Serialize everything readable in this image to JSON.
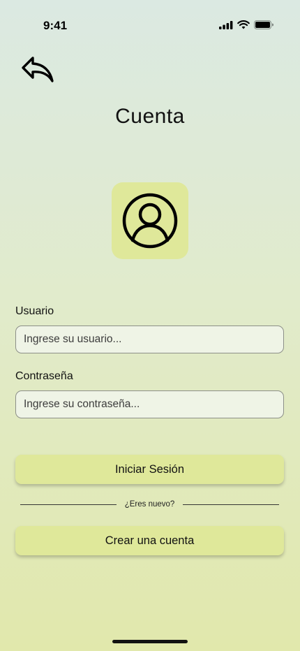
{
  "status_bar": {
    "time": "9:41"
  },
  "header": {
    "title": "Cuenta",
    "back_icon": "reply-arrow-icon"
  },
  "avatar": {
    "icon": "user-circle-icon",
    "tile_color": "#dfe89a"
  },
  "form": {
    "username_label": "Usuario",
    "username_placeholder": "Ingrese su usuario...",
    "username_value": "",
    "password_label": "Contraseña",
    "password_placeholder": "Ingrese su contraseña...",
    "password_value": ""
  },
  "actions": {
    "login_label": "Iniciar Sesión",
    "divider_text": "¿Eres nuevo?",
    "signup_label": "Crear una cuenta"
  },
  "colors": {
    "accent": "#dfe89a",
    "input_background": "#eff4e6",
    "background_top": "#dbe9e2",
    "background_bottom": "#e1e8ac"
  }
}
